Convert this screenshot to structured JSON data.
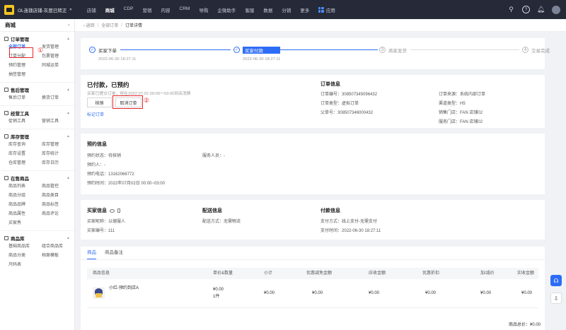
{
  "topbar": {
    "shop_name": "OL连锁店铺-灰度已转正",
    "nav": [
      "店铺",
      "商城",
      "CDP",
      "营销",
      "内容",
      "CRM",
      "导购",
      "企微助手",
      "客服",
      "数据",
      "分销",
      "更多"
    ],
    "active_nav": "商城",
    "app_label": "应用"
  },
  "sidebar": {
    "title": "商城",
    "groups": [
      {
        "label": "订单管理",
        "items": [
          "全部订单",
          "发货管理",
          "订单分配",
          "包裹管理",
          "预约管理",
          "同城运单",
          "抽签管理"
        ],
        "selected": "全部订单"
      },
      {
        "label": "售后管理",
        "items": [
          "售后订单",
          "换货订单"
        ]
      },
      {
        "label": "经营工具",
        "items": [
          "促销工具",
          "营销工具"
        ]
      },
      {
        "label": "库存管理",
        "items": [
          "库存查询",
          "库存管理",
          "库存设置",
          "库存统计",
          "仓库管理",
          "库存日历"
        ]
      },
      {
        "label": "在售商品",
        "items": [
          "商品列表",
          "商品管控",
          "商品分组",
          "商品类目",
          "商品品牌",
          "商品标签",
          "商品属性",
          "商品评论",
          "买家秀"
        ]
      },
      {
        "label": "商品库",
        "items": [
          "基础商品库",
          "组合商品库",
          "商品分类",
          "档案模板",
          "尺码表"
        ]
      }
    ]
  },
  "annotations": {
    "one": "①",
    "two": "②"
  },
  "breadcrumb": {
    "back": "返回",
    "parent": "全部订单",
    "current": "订单详情"
  },
  "steps": [
    {
      "num": "✓",
      "label": "买家下单",
      "time": "2022-06-30 18:27:11"
    },
    {
      "num": "✓",
      "label": "买家付款",
      "time": "2022-06-30 18:27:11"
    },
    {
      "num": "3",
      "label": "商家发货",
      "time": ""
    },
    {
      "num": "4",
      "label": "交易完成",
      "time": ""
    }
  ],
  "status": {
    "title": "已付款，已预约",
    "desc": "买家已提交订单，将在2022.07.02 00:00～03:00到店消费",
    "verify_btn": "核销",
    "cancel_btn": "取消订单",
    "mark_link": "标记订单"
  },
  "order_info": {
    "title": "订单信息",
    "left": [
      {
        "k": "订单编号：",
        "v": "308507345096432"
      },
      {
        "k": "订单类型：",
        "v": "虚拟订单"
      },
      {
        "k": "父单号：",
        "v": "308507346000432"
      }
    ],
    "right": [
      {
        "k": "订单来源：",
        "v": "系统内部订单"
      },
      {
        "k": "渠道类型：",
        "v": "H5"
      },
      {
        "k": "销售门店：",
        "v": "FAN 店铺02"
      },
      {
        "k": "服务门店：",
        "v": "FAN 店铺02"
      }
    ]
  },
  "reservation": {
    "title": "预约信息",
    "rows": [
      {
        "k": "预约状态：",
        "v": "待核销"
      },
      {
        "k": "预约人：",
        "v": "-"
      },
      {
        "k": "预约电话：",
        "v": "13162066772"
      },
      {
        "k": "预约时间：",
        "v": "2022年07月02日 00:00~03:00"
      }
    ],
    "staff": {
      "k": "服务人员：",
      "v": "-"
    }
  },
  "buyer": {
    "title": "买家信息",
    "rows": [
      {
        "k": "买家昵称：",
        "v": "以德服人"
      },
      {
        "k": "买家编号：",
        "v": "111"
      }
    ]
  },
  "delivery": {
    "title": "配送信息",
    "rows": [
      {
        "k": "配送方式：",
        "v": "无需物流"
      }
    ]
  },
  "payment": {
    "title": "付款信息",
    "rows": [
      {
        "k": "支付方式：",
        "v": "线上支付-无需支付"
      },
      {
        "k": "支付时间：",
        "v": "2022-06-30 18:27:11"
      }
    ]
  },
  "products": {
    "tabs": [
      "商品",
      "商品备注"
    ],
    "headers": [
      "商品信息",
      "单价&数量",
      "小计",
      "优惠减免金额",
      "应收金额",
      "优惠折扣",
      "加/减价",
      "实收金额"
    ],
    "row": {
      "name": "小红-预约到店A",
      "price": "¥0.00",
      "qty": "1件",
      "subtotal": "¥0.00",
      "discount_amt": "¥0.00",
      "receivable": "¥0.00",
      "discount": "¥0.00",
      "adjust": "¥0.00",
      "received": "¥0.00"
    },
    "total": "商品总价：¥0.00"
  }
}
